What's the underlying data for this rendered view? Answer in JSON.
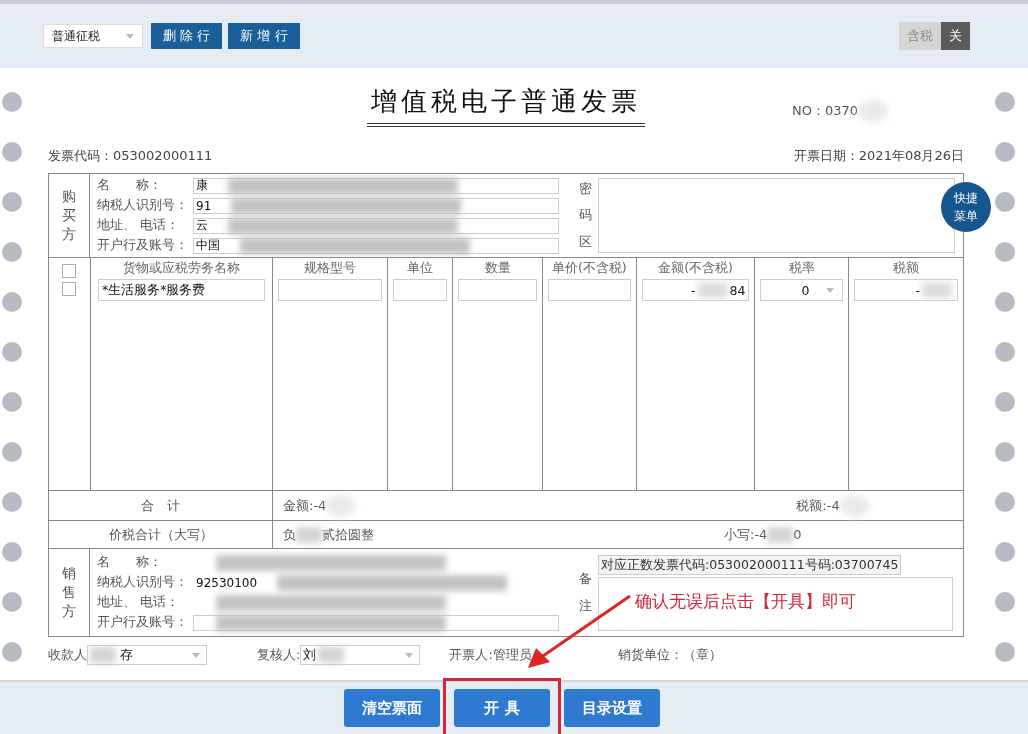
{
  "toolbar": {
    "invoice_type": "普通征税",
    "buttons": [
      "删 除 行",
      "新 增 行"
    ],
    "tax_toggle": {
      "label": "含税",
      "state_label": "关",
      "on": false
    }
  },
  "invoice": {
    "title": "增值税电子普通发票",
    "number": "NO：0370",
    "number_redacted": true,
    "code": "发票代码：053002000111",
    "date": "开票日期：2021年08月26日",
    "buyer": {
      "section_label": "购买方",
      "fields": [
        {
          "label": "名　　称：",
          "value": "康",
          "redacted": true
        },
        {
          "label": "纳税人识别号：",
          "value": "91",
          "redacted": true
        },
        {
          "label": "地址、 电话：",
          "value": "云",
          "redacted": true
        },
        {
          "label": "开户行及账号：",
          "value": "中国",
          "redacted": true
        }
      ],
      "password_label": "密码区"
    },
    "quick_menu": "快捷菜单",
    "columns": [
      "货物或应税劳务名称",
      "规格型号",
      "单位",
      "数量",
      "单价(不含税)",
      "金额(不含税)",
      "税率",
      "税额"
    ],
    "rows": [
      {
        "checked": false,
        "name": "*生活服务*服务费",
        "spec": "",
        "unit": "",
        "quantity": "",
        "price": "",
        "amount": [
          "-",
          "84"
        ],
        "rate": [
          "0"
        ],
        "tax": [
          "-"
        ]
      },
      {
        "checked": false
      }
    ],
    "total_label": "合　计",
    "total_amount": [
      "金额:-4"
    ],
    "total_tax": [
      "税额:-4"
    ],
    "grand_label": "价税合计（大写）",
    "grand_words": [
      "负",
      "贰拾圆整"
    ],
    "grand_small": [
      "小写:-4",
      "0"
    ],
    "seller": {
      "section_label": "销售方",
      "fields": [
        {
          "label": "名　　称：",
          "redacted": true
        },
        {
          "label": "纳税人识别号：",
          "value": "92530100",
          "redacted": true
        },
        {
          "label": "地址、 电话：",
          "redacted": true
        },
        {
          "label": "开户行及账号：",
          "redacted": true
        }
      ],
      "remark_label": "备注",
      "remark": "对应正数发票代码:053002000111号码:03700745"
    },
    "footer": {
      "payee_label": "收款人",
      "payee": [
        "存"
      ],
      "reviewer_label": "复核人:",
      "reviewer": [
        "刘"
      ],
      "drawer": "开票人:管理员",
      "seller_unit": "销货单位：（章）"
    }
  },
  "annotation": {
    "text": "确认无误后点击【开具】即可"
  },
  "actions": [
    {
      "label": "清空票面",
      "highlighted": false
    },
    {
      "label": "开 具",
      "highlighted": true
    },
    {
      "label": "目录设置",
      "highlighted": false
    }
  ]
}
